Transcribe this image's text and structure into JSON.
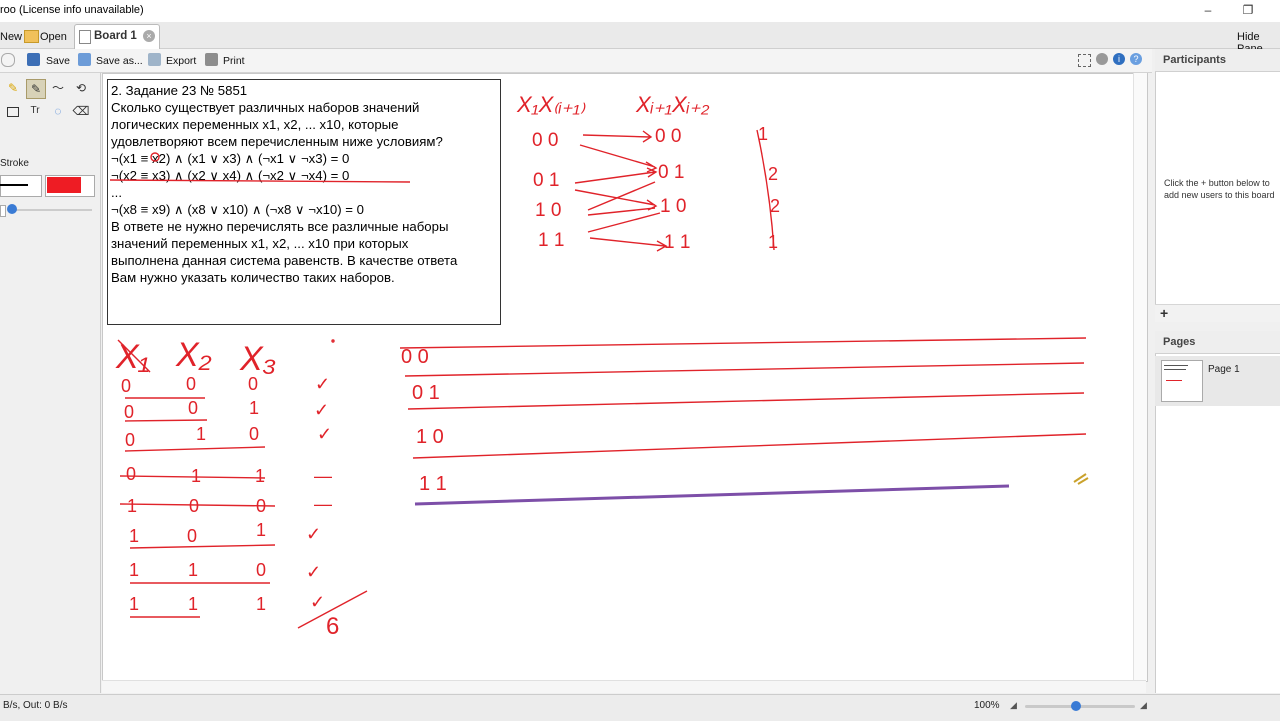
{
  "window": {
    "title": "roo (License info unavailable)",
    "minimize": "–",
    "restore": "❐"
  },
  "tabs": {
    "new_label": "New",
    "open_label": "Open",
    "board_label": "Board 1",
    "hide_panel_label": "Hide Pane"
  },
  "toolbar": {
    "save_label": "Save",
    "save_as_label": "Save as...",
    "export_label": "Export",
    "print_label": "Print"
  },
  "leftpanel": {
    "stroke_label": "Stroke",
    "stroke_color": "#000000",
    "fill_color": "#ee1c24",
    "text_tool_glyph": "Tr"
  },
  "task": {
    "lines": [
      "2. Задание 23 № 5851",
      "Сколько существует различных наборов значений",
      "логических переменных x1, x2, ... x10, которые",
      "удовлетворяют всем перечисленным ниже условиям?",
      "",
      "¬(x1 ≡ x2) ∧ (x1 ∨ x3) ∧ (¬x1 ∨ ¬x3) = 0",
      "¬(x2 ≡ x3) ∧ (x2 ∨ x4) ∧ (¬x2 ∨ ¬x4) = 0",
      "...",
      "¬(x8 ≡ x9) ∧ (x8 ∨ x10) ∧ (¬x8 ∨ ¬x10) = 0",
      "",
      "В ответе не нужно перечислять все различные наборы",
      "значений переменных x1, x2, ... x10 при которых",
      "выполнена данная система равенств. В качестве ответа",
      "Вам нужно указать количество таких наборов."
    ]
  },
  "sketch": {
    "color": "#e0232a",
    "head_left": "X₁X₍ᵢ₊₁₎",
    "head_right": "Xᵢ₊₁Xᵢ₊₂",
    "pairs_left": [
      "0 0",
      "0 1",
      "1 0",
      "1 1"
    ],
    "pairs_right": [
      "0 0",
      "0 1",
      "1 0",
      "1 1"
    ],
    "counts": [
      "1",
      "2",
      "2",
      "1"
    ],
    "table_header": [
      "X₁",
      "X₂",
      "X₃"
    ],
    "table_rows": [
      [
        "0",
        "0",
        "0",
        "✓"
      ],
      [
        "0",
        "0",
        "1",
        "✓"
      ],
      [
        "0",
        "1",
        "0",
        "✓"
      ],
      [
        "0",
        "1",
        "1",
        "—"
      ],
      [
        "1",
        "0",
        "0",
        "—"
      ],
      [
        "1",
        "0",
        "1",
        "✓"
      ],
      [
        "1",
        "1",
        "0",
        "✓"
      ],
      [
        "1",
        "1",
        "1",
        "✓"
      ]
    ],
    "total": "6",
    "right_rows": [
      "0 0",
      "0 1",
      "1 0",
      "1 1"
    ]
  },
  "panels": {
    "participants_title": "Participants",
    "participants_hint": "Click the + button below to add new users to this board",
    "pages_title": "Pages",
    "page_label": "Page 1",
    "add_glyph": "+"
  },
  "status": {
    "traffic": "B/s, Out: 0 B/s",
    "zoom": "100%"
  }
}
